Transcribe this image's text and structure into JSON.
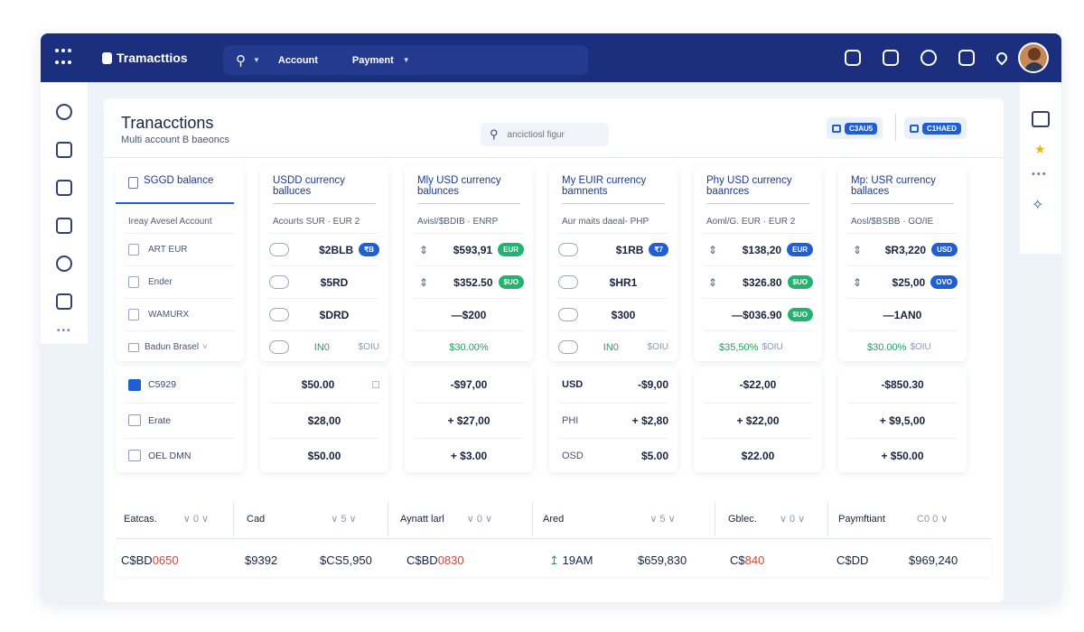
{
  "header": {
    "app_title": "Tramacttios",
    "nav": [
      "Account",
      "Payment"
    ],
    "avatar_label": "User avatar"
  },
  "page": {
    "title": "Tranacctions",
    "subtitle": "Multi account B baeoncs",
    "search_placeholder": "ancictiosl figur",
    "button_a": "C3AU5",
    "button_b": "C1HAED"
  },
  "columns": [
    {
      "head": "SGGD balance",
      "sub": "Ireay Avesel Account",
      "rows": [
        {
          "label": "ART EUR",
          "value": ""
        },
        {
          "label": "Ender",
          "value": ""
        },
        {
          "label": "WAMURX",
          "value": ""
        },
        {
          "label": "Badun Brasel",
          "value": ""
        }
      ]
    },
    {
      "head": "USDD currency balluces",
      "sub": "Acourts SUR · EUR 2",
      "rows": [
        {
          "value": "$2BLB",
          "chip": "₹B"
        },
        {
          "value": "$5RD"
        },
        {
          "value": "$DRD"
        },
        {
          "value": "IN0",
          "select": "$OIU"
        }
      ]
    },
    {
      "head": "Mly USD currency balunces",
      "sub": "Avisl/$BDIB · ENRP",
      "rows": [
        {
          "value": "$593,91",
          "chip": "EUR"
        },
        {
          "value": "$352.50",
          "chip": "$UO"
        },
        {
          "value": "—$200"
        },
        {
          "value": "$30.00%"
        }
      ]
    },
    {
      "head": "My EUIR currency bamnents",
      "sub": "Aur maits daeal- PHP",
      "rows": [
        {
          "value": "$1RB",
          "chip": "₹7"
        },
        {
          "value": "$HR1"
        },
        {
          "value": "$300"
        },
        {
          "value": "IN0",
          "select": "$OIU"
        }
      ]
    },
    {
      "head": "Phy USD currency baanrces",
      "sub": "Aoml/G. EUR · EUR 2",
      "rows": [
        {
          "value": "$138,20",
          "chip": "EUR"
        },
        {
          "value": "$326.80",
          "chip": "$UO"
        },
        {
          "value": "—$036.90",
          "chip": "$UO"
        },
        {
          "value": "$35,50%",
          "select": "$OIU"
        }
      ]
    },
    {
      "head": "Mp: USR currency ballaces",
      "sub": "Aosl/$BSBB · GO/IE",
      "rows": [
        {
          "value": "$R3,220",
          "chip": "USD"
        },
        {
          "value": "$25,00",
          "chip": "OVO"
        },
        {
          "value": "—1AN0"
        },
        {
          "value": "$30.00%",
          "select": "$OIU"
        }
      ]
    }
  ],
  "bottom_cards": [
    {
      "rows": [
        {
          "label": "C5929"
        },
        {
          "label": "Erate"
        },
        {
          "label": "OEL DMN"
        }
      ]
    },
    {
      "rows": [
        {
          "value": "$50.00"
        },
        {
          "value": "$28,00"
        },
        {
          "value": "$50.00"
        }
      ]
    },
    {
      "rows": [
        {
          "value": "-$97,00"
        },
        {
          "value": "+ $27,00"
        },
        {
          "value": "+  $3.00"
        }
      ]
    },
    {
      "rows": [
        {
          "label": "USD",
          "value": "-$9,00"
        },
        {
          "label": "PHI",
          "value": "+ $2,80"
        },
        {
          "label": "OSD",
          "value": "$5.00"
        }
      ]
    },
    {
      "rows": [
        {
          "value": "-$22,00"
        },
        {
          "value": "+ $22,00"
        },
        {
          "value": "$22.00"
        }
      ]
    },
    {
      "rows": [
        {
          "value": "-$850.30"
        },
        {
          "value": "+ $9,5,00"
        },
        {
          "value": "+ $50.00"
        }
      ]
    }
  ],
  "summary": {
    "headers": [
      {
        "label": "Eatcas.",
        "controls": "∨ 0 ∨"
      },
      {
        "label": "Cad",
        "controls": "∨ 5 ∨"
      },
      {
        "label": "Aynatt larl",
        "controls": "∨ 0 ∨"
      },
      {
        "label": "Ared",
        "controls": "∨ 5 ∨"
      },
      {
        "label": "Gblec.",
        "controls": "∨ 0 ∨"
      },
      {
        "label": "Paymftiant",
        "controls": "C0 0 ∨"
      }
    ],
    "row": {
      "v1_prefix": "C$BD",
      "v1_red": "0650",
      "v2": "$9392",
      "v3": "$CS5,950",
      "v4_prefix": "C$BD",
      "v4_red": "0830",
      "v5_arrow": "↥",
      "v5": "19AM",
      "v6": "$659,830",
      "v7_prefix": "C$",
      "v7_red": "840",
      "v8": "C$DD",
      "v9": "$969,240"
    }
  },
  "colors": {
    "brand": "#1b2f7e",
    "accent": "#1f5fd1",
    "positive": "#22b36e",
    "negative": "#c84a3e"
  }
}
